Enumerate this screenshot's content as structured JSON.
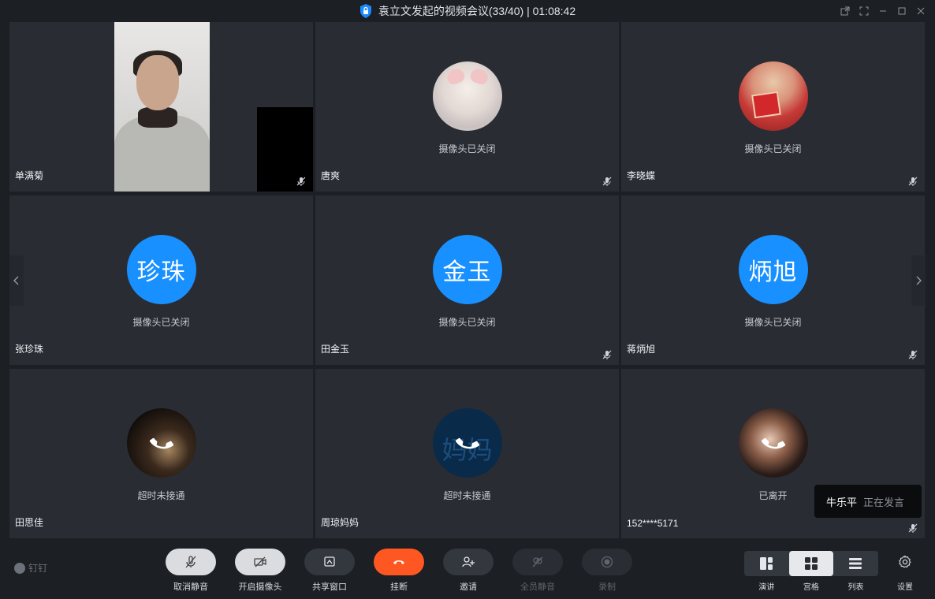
{
  "window": {
    "title": "袁立文发起的视频会议(33/40) | 01:08:42"
  },
  "tiles": [
    {
      "name": "单满菊",
      "status": "",
      "avatar": "video",
      "muted": true
    },
    {
      "name": "唐爽",
      "status": "摄像头已关闭",
      "avatar": "cat-photo",
      "muted": true
    },
    {
      "name": "李晓蝶",
      "status": "摄像头已关闭",
      "avatar": "girl-photo",
      "muted": true
    },
    {
      "name": "张珍珠",
      "status": "摄像头已关闭",
      "avatar_text": "珍珠",
      "muted": false
    },
    {
      "name": "田金玉",
      "status": "摄像头已关闭",
      "avatar_text": "金玉",
      "muted": true
    },
    {
      "name": "蒋炳旭",
      "status": "摄像头已关闭",
      "avatar_text": "炳旭",
      "muted": true
    },
    {
      "name": "田思佳",
      "status": "超时未接通",
      "avatar": "dark-photo",
      "muted": false
    },
    {
      "name": "周琼妈妈",
      "status": "超时未接通",
      "avatar_text": "妈妈",
      "muted": false
    },
    {
      "name": "152****5171",
      "status": "已离开",
      "avatar": "portrait-photo",
      "muted": true
    }
  ],
  "speaking": {
    "who": "牛乐平",
    "what": "正在发言"
  },
  "toolbar": {
    "brand": "钉钉",
    "unmute": "取消静音",
    "camera_on": "开启摄像头",
    "share": "共享窗口",
    "hangup": "挂断",
    "invite": "邀请",
    "mute_all": "全员静音",
    "record": "录制",
    "layout_speaker": "演讲",
    "layout_grid": "宫格",
    "layout_list": "列表",
    "settings": "设置"
  },
  "colors": {
    "accent_blue": "#1890ff",
    "hangup_red": "#ff5722",
    "tile_bg": "#292c33"
  }
}
